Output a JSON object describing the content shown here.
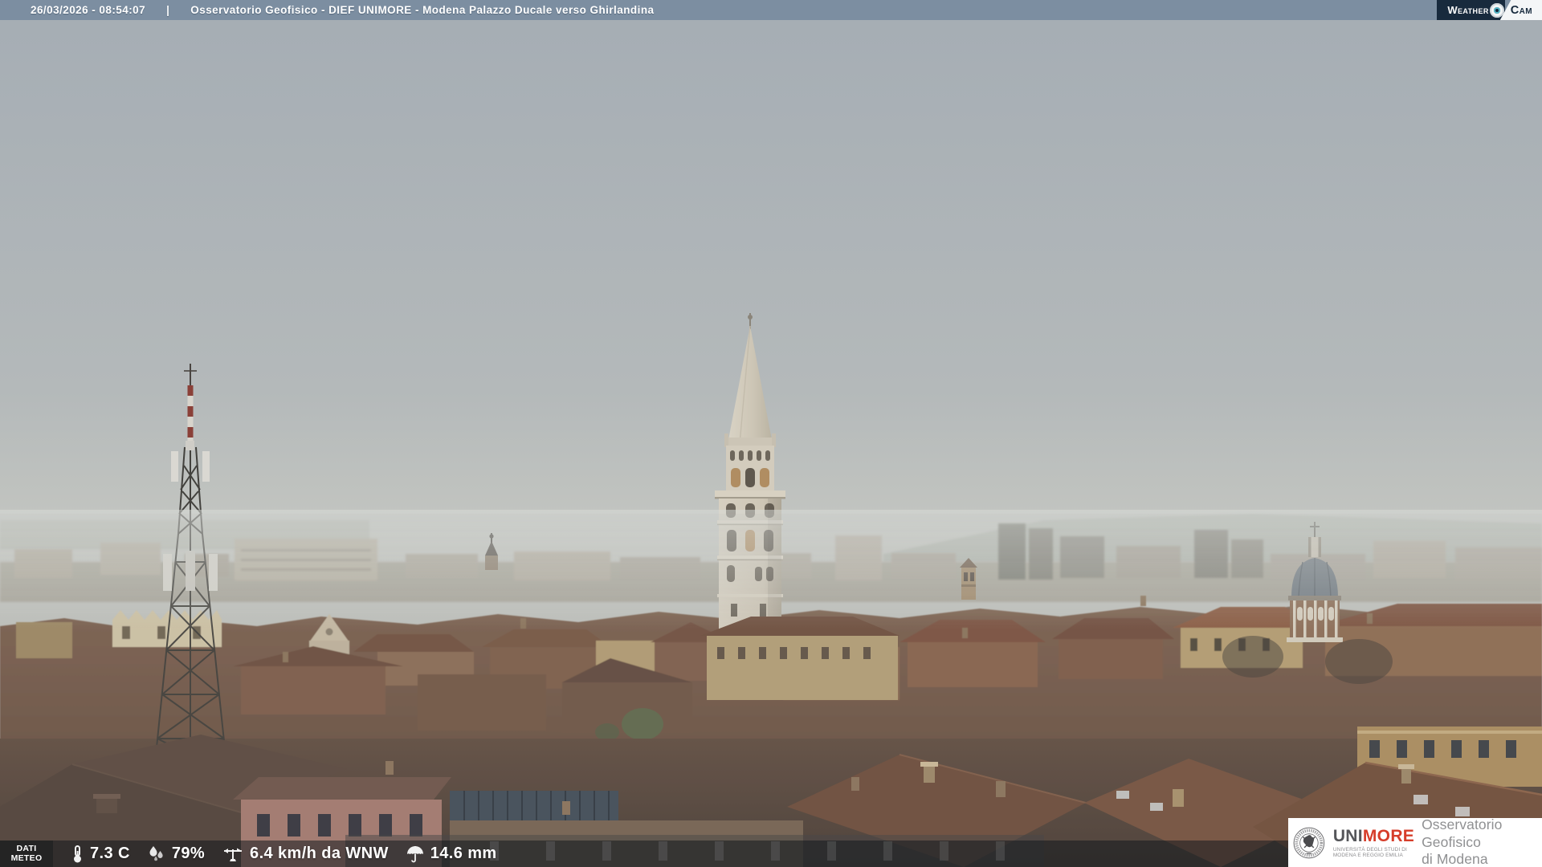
{
  "header": {
    "datetime": "26/03/2026 - 08:54:07",
    "separator": "|",
    "title": "Osservatorio Geofisico - DIEF UNIMORE - Modena Palazzo Ducale verso Ghirlandina"
  },
  "logo": {
    "weather": "Weather",
    "cam": "Cam"
  },
  "weather_bar": {
    "label": [
      "DATI",
      "METEO"
    ],
    "readings": [
      {
        "icon": "thermometer-icon",
        "value": "7.3 C"
      },
      {
        "icon": "humidity-icon",
        "value": "79%"
      },
      {
        "icon": "wind-vane-icon",
        "value": "6.4 km/h da WNW"
      },
      {
        "icon": "umbrella-icon",
        "value": "14.6 mm"
      }
    ]
  },
  "branding": {
    "acronym_gray": "UNI",
    "acronym_red": "MORE",
    "university_line1": "UNIVERSITÀ DEGLI STUDI DI",
    "university_line2": "MODENA E REGGIO EMILIA",
    "observatory_line1": "Osservatorio Geofisico",
    "observatory_line2": "di Modena"
  },
  "colors": {
    "top_bar": "#7c8ea1",
    "logo_navy": "#182a3d",
    "unimore_red": "#d63d2a",
    "bottom_bar": "rgba(16,22,27,0.52)",
    "sky_top": "#a5adb4",
    "sky_horizon": "#c4c6c1",
    "rooftops": "#6d5243"
  }
}
